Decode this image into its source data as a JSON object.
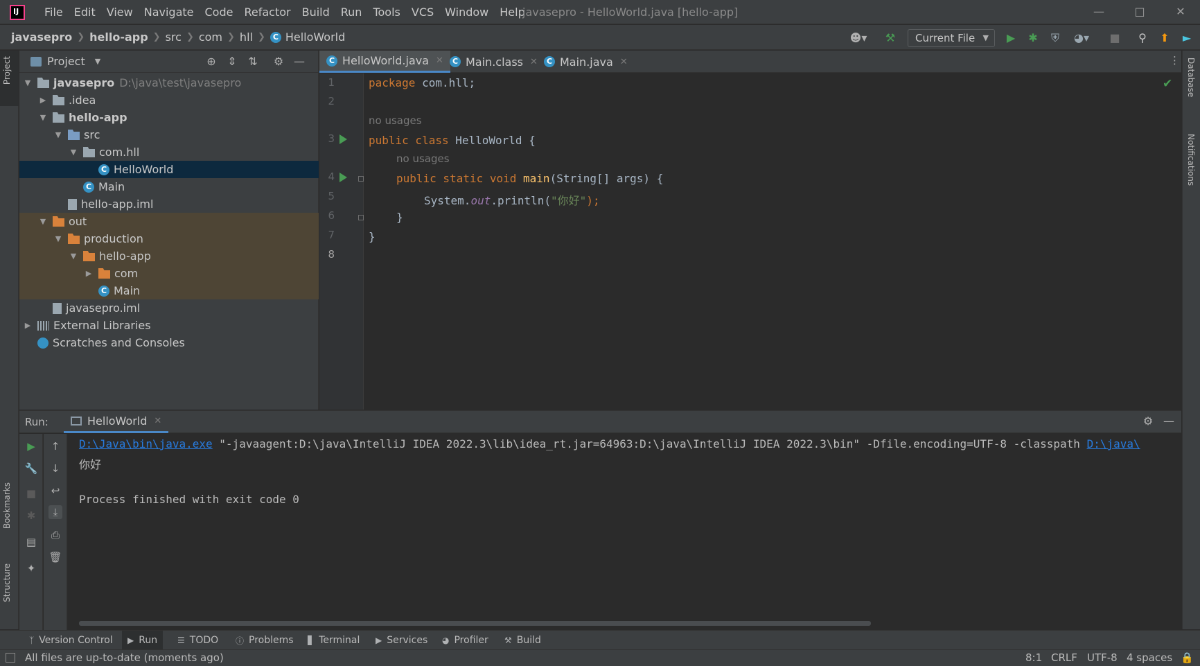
{
  "window": {
    "title": "javasepro - HelloWorld.java [hello-app]",
    "menu": [
      "File",
      "Edit",
      "View",
      "Navigate",
      "Code",
      "Refactor",
      "Build",
      "Run",
      "Tools",
      "VCS",
      "Window",
      "Help"
    ],
    "logo_text": "IJ"
  },
  "breadcrumb": [
    "javasepro",
    "hello-app",
    "src",
    "com",
    "hll",
    "HelloWorld"
  ],
  "toolbar": {
    "run_config": "Current File"
  },
  "left_strip": {
    "project": "Project",
    "bookmarks": "Bookmarks",
    "structure": "Structure"
  },
  "right_strip": {
    "database": "Database",
    "notifications": "Notifications"
  },
  "project_panel": {
    "title": "Project",
    "tree": [
      {
        "label": "javasepro",
        "hint": "D:\\java\\test\\javasepro"
      },
      {
        "label": ".idea"
      },
      {
        "label": "hello-app"
      },
      {
        "label": "src"
      },
      {
        "label": "com.hll"
      },
      {
        "label": "HelloWorld"
      },
      {
        "label": "Main"
      },
      {
        "label": "hello-app.iml"
      },
      {
        "label": "out"
      },
      {
        "label": "production"
      },
      {
        "label": "hello-app"
      },
      {
        "label": "com"
      },
      {
        "label": "Main"
      },
      {
        "label": "javasepro.iml"
      },
      {
        "label": "External Libraries"
      },
      {
        "label": "Scratches and Consoles"
      }
    ]
  },
  "editor": {
    "tabs": [
      "HelloWorld.java",
      "Main.class",
      "Main.java"
    ],
    "line_numbers": [
      "1",
      "2",
      "3",
      "4",
      "5",
      "6",
      "7",
      "8"
    ],
    "hint_no_usages": "no usages",
    "code": {
      "l1_kw": "package",
      "l1_rest": " com.hll;",
      "l3_kw": "public class",
      "l3_rest": " HelloWorld {",
      "l4_kw": "public static void",
      "l4_fn": " main",
      "l4_rest": "(String[] args) {",
      "l5_a": "System.",
      "l5_fld": "out",
      "l5_b": ".println(",
      "l5_str": "\"你好\"",
      "l5_c": ");",
      "l6": "}",
      "l7": "}"
    }
  },
  "run_panel": {
    "label": "Run:",
    "tab": "HelloWorld",
    "console": {
      "link1": "D:\\Java\\bin\\java.exe",
      "cmd": " \"-javaagent:D:\\java\\IntelliJ IDEA 2022.3\\lib\\idea_rt.jar=64963:D:\\java\\IntelliJ IDEA 2022.3\\bin\" -Dfile.encoding=UTF-8 -classpath ",
      "link2": "D:\\java\\",
      "output": "你好",
      "exit": "Process finished with exit code 0"
    }
  },
  "bottom_tools": [
    "Version Control",
    "Run",
    "TODO",
    "Problems",
    "Terminal",
    "Services",
    "Profiler",
    "Build"
  ],
  "status": {
    "message": "All files are up-to-date (moments ago)",
    "position": "8:1",
    "line_sep": "CRLF",
    "encoding": "UTF-8",
    "indent": "4 spaces"
  }
}
